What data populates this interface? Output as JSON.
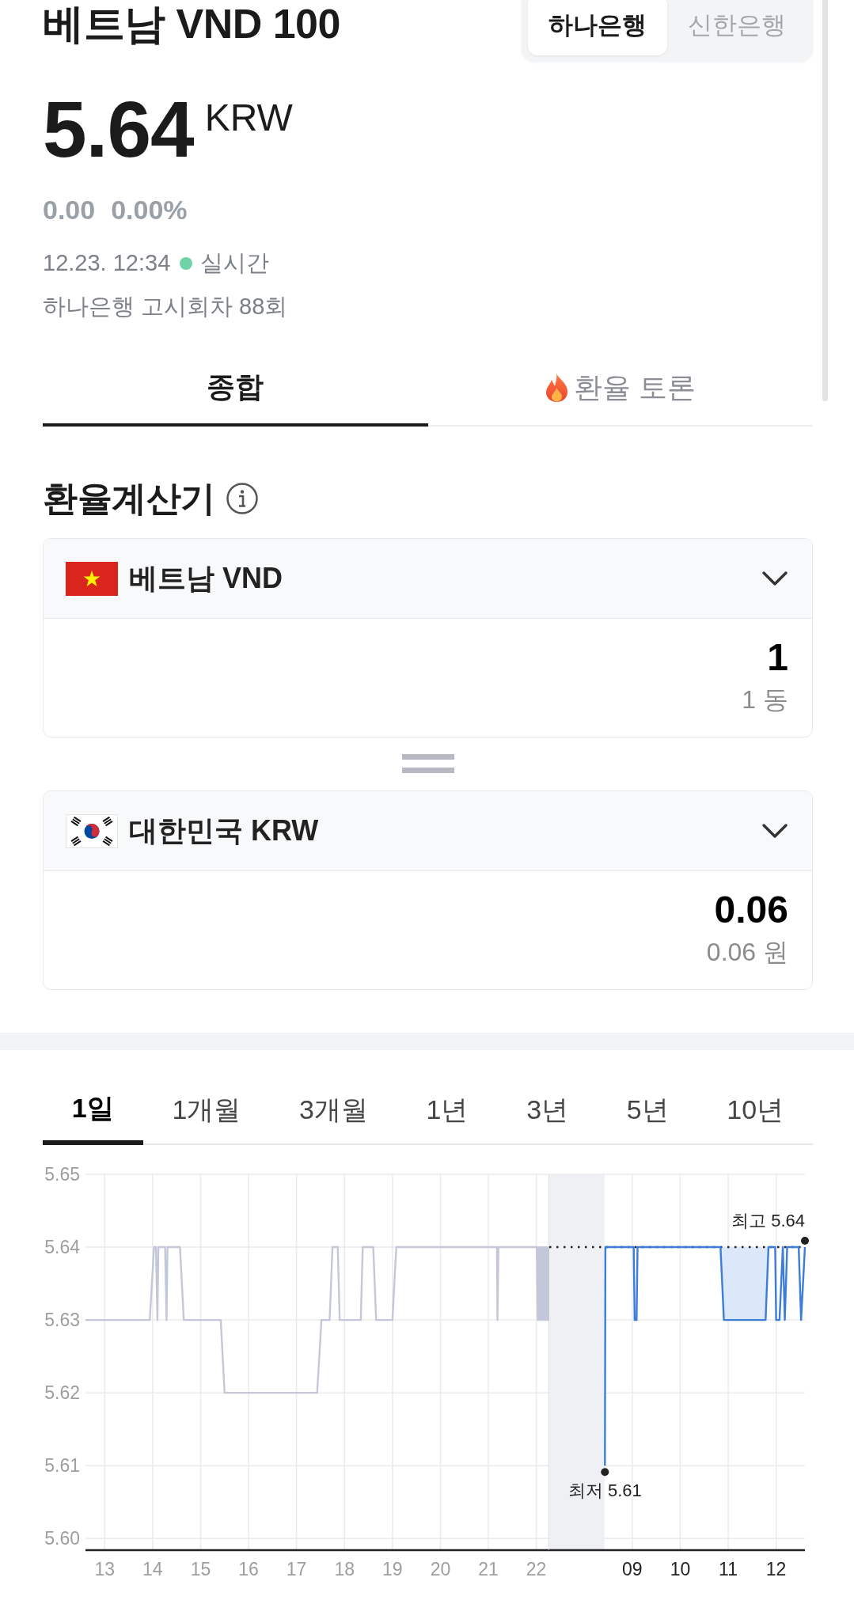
{
  "header": {
    "title": "베트남 VND 100",
    "banks": [
      {
        "label": "하나은행",
        "selected": true
      },
      {
        "label": "신한은행",
        "selected": false
      }
    ]
  },
  "quote": {
    "price": "5.64",
    "unit": "KRW",
    "change": "0.00",
    "change_percent": "0.00%",
    "time": "12.23. 12:34",
    "live": true,
    "live_label": "실시간",
    "notice": "하나은행 고시회차 88회"
  },
  "tabs": [
    {
      "label": "종합",
      "selected": true,
      "kind": "plain"
    },
    {
      "label": "환율 토론",
      "selected": false,
      "kind": "hot"
    }
  ],
  "calculator": {
    "title": "환율계산기",
    "converters": [
      {
        "kind": "vn",
        "currency": "베트남 VND",
        "amount": "1",
        "amount_text": "1 동"
      },
      {
        "kind": "kr",
        "currency": "대한민국 KRW",
        "amount": "0.06",
        "amount_text": "0.06 원"
      }
    ]
  },
  "chart": {
    "periods": [
      {
        "label": "1일",
        "selected": true
      },
      {
        "label": "1개월",
        "selected": false
      },
      {
        "label": "3개월",
        "selected": false
      },
      {
        "label": "1년",
        "selected": false
      },
      {
        "label": "3년",
        "selected": false
      },
      {
        "label": "5년",
        "selected": false
      },
      {
        "label": "10년",
        "selected": false
      }
    ],
    "panels": [
      {
        "chart_data": {
          "type": "line",
          "x": [
            12.6,
            13.94,
            14.03,
            14.07,
            14.1,
            14.12,
            14.26,
            14.29,
            14.31,
            14.57,
            14.65,
            15.42,
            15.5,
            17.43,
            17.52,
            17.69,
            17.75,
            17.86,
            17.9,
            18.34,
            18.38,
            18.6,
            18.66,
            19.0,
            19.08,
            21.18,
            21.19,
            21.21,
            22.01,
            22.03,
            22.05,
            22.07,
            22.09,
            22.11,
            22.13,
            22.15,
            22.17,
            22.19,
            22.21,
            22.23,
            22.25,
            22.26,
            22.27
          ],
          "series": [
            {
              "color": "#c4c7d9",
              "values": [
                5.63,
                5.63,
                5.64,
                5.64,
                5.63,
                5.64,
                5.64,
                5.63,
                5.64,
                5.64,
                5.63,
                5.63,
                5.62,
                5.62,
                5.63,
                5.63,
                5.64,
                5.64,
                5.63,
                5.63,
                5.64,
                5.64,
                5.63,
                5.63,
                5.64,
                5.64,
                5.63,
                5.64,
                5.64,
                5.63,
                5.64,
                5.63,
                5.64,
                5.63,
                5.64,
                5.63,
                5.64,
                5.63,
                5.64,
                5.63,
                5.64,
                5.63,
                5.64
              ]
            }
          ],
          "xlim": [
            12.6,
            22.27
          ],
          "ylim": [
            5.5984,
            5.65
          ],
          "xticks": [
            13,
            14,
            15,
            16,
            17,
            18,
            19,
            20,
            21,
            22
          ],
          "yticks": [
            {
              "value": 5.6,
              "label": "5.60"
            },
            {
              "value": 5.61,
              "label": "5.61"
            },
            {
              "value": 5.62,
              "label": "5.62"
            },
            {
              "value": 5.63,
              "label": "5.63"
            },
            {
              "value": 5.64,
              "label": "5.64"
            },
            {
              "value": 5.65,
              "label": "5.65"
            }
          ],
          "grid": true
        }
      },
      {
        "chart_data": {
          "type": "line",
          "x": [
            8.43,
            8.44,
            9.03,
            9.05,
            9.09,
            9.11,
            10.84,
            10.91,
            11.78,
            11.84,
            11.98,
            12.0,
            12.07,
            12.14,
            12.18,
            12.23,
            12.47,
            12.52,
            12.6
          ],
          "series": [
            {
              "color": "#3b7dd8",
              "values": [
                5.61,
                5.64,
                5.64,
                5.63,
                5.63,
                5.64,
                5.64,
                5.63,
                5.63,
                5.64,
                5.64,
                5.63,
                5.63,
                5.64,
                5.63,
                5.64,
                5.64,
                5.63,
                5.64
              ]
            }
          ],
          "xlim": [
            7.27,
            12.6
          ],
          "ylim": [
            5.5984,
            5.65
          ],
          "xticks": [
            {
              "value": 9,
              "label": "09"
            },
            10,
            11,
            12
          ],
          "grid": true,
          "bands": [
            {
              "axis": "x",
              "from": 7.27,
              "to": 8.42
            }
          ],
          "ref_lines": [
            {
              "axis": "y",
              "value": 5.64
            }
          ],
          "annotations": [
            {
              "text": "최고 5.64",
              "x": 12.6,
              "y": 5.64
            },
            {
              "text": "최저 5.61",
              "x": 8.43,
              "y": 5.61
            }
          ]
        }
      }
    ]
  }
}
